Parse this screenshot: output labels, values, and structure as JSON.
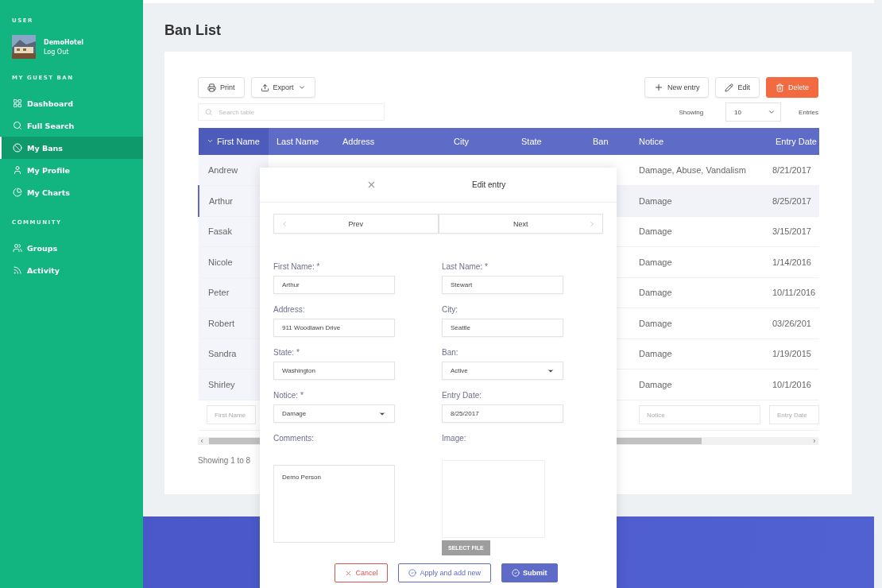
{
  "sidebar": {
    "user_heading": "USER",
    "user": {
      "name": "DemoHotel",
      "logout": "Log Out"
    },
    "sections": [
      {
        "heading": "MY GUEST BAN",
        "items": [
          {
            "label": "Dashboard",
            "selected": false
          },
          {
            "label": "Full Search",
            "selected": false
          },
          {
            "label": "My Bans",
            "selected": true
          },
          {
            "label": "My Profile",
            "selected": false
          },
          {
            "label": "My Charts",
            "selected": false
          }
        ]
      },
      {
        "heading": "COMMUNITY",
        "items": [
          {
            "label": "Groups",
            "selected": false
          },
          {
            "label": "Activity",
            "selected": false
          }
        ]
      }
    ]
  },
  "page_title": "Ban List",
  "toolbar": {
    "print": "Print",
    "export": "Export",
    "new_entry": "New entry",
    "edit": "Edit",
    "delete": "Delete",
    "search_placeholder": "Search table",
    "showing": "Showing",
    "page_size": "10",
    "entries": "Entries"
  },
  "table": {
    "columns": [
      "First Name",
      "Last Name",
      "Address",
      "City",
      "State",
      "Ban",
      "Notice",
      "Entry Date"
    ],
    "rows": [
      {
        "first_name": "Andrew",
        "notice": "Damage, Abuse, Vandalism",
        "entry_date": "8/21/2017",
        "selected": false
      },
      {
        "first_name": "Arthur",
        "notice": "Damage",
        "entry_date": "8/25/2017",
        "selected": true
      },
      {
        "first_name": "Fasak",
        "notice": "Damage",
        "entry_date": "3/15/2017",
        "selected": false
      },
      {
        "first_name": "Nicole",
        "notice": "Damage",
        "entry_date": "1/14/2016",
        "selected": false
      },
      {
        "first_name": "Peter",
        "notice": "Damage",
        "entry_date": "10/11/2016",
        "selected": false
      },
      {
        "first_name": "Robert",
        "notice": "Damage",
        "entry_date": "03/26/201",
        "selected": false
      },
      {
        "first_name": "Sandra",
        "notice": "Damage",
        "entry_date": "1/19/2015",
        "selected": false
      },
      {
        "first_name": "Shirley",
        "notice": "Damage",
        "entry_date": "10/1/2016",
        "selected": false
      }
    ],
    "filters": {
      "first_name": {
        "placeholder": "First Name"
      },
      "notice": {
        "placeholder": "Notice"
      },
      "entry_date": {
        "placeholder": "Entry Date"
      }
    },
    "footer": "Showing 1 to 8"
  },
  "modal": {
    "title": "Edit entry",
    "prev": "Prev",
    "next": "Next",
    "fields": [
      {
        "label": "First Name: *",
        "value": "Arthur",
        "kind": "text"
      },
      {
        "label": "Last Name: *",
        "value": "Stewart",
        "kind": "text"
      },
      {
        "label": "Address:",
        "value": "911 Woodlawn Drive",
        "kind": "text"
      },
      {
        "label": "City:",
        "value": "Seattle",
        "kind": "text"
      },
      {
        "label": "State: *",
        "value": "Washington",
        "kind": "text"
      },
      {
        "label": "Ban:",
        "value": "Active",
        "kind": "select"
      },
      {
        "label": "Notice: *",
        "value": "Damage",
        "kind": "select"
      },
      {
        "label": "Entry Date:",
        "value": "8/25/2017",
        "kind": "text"
      }
    ],
    "comments": {
      "label": "Comments:",
      "value": "Demo Person"
    },
    "image": {
      "label": "Image:",
      "button": "SELECT FILE"
    },
    "buttons": {
      "cancel": "Cancel",
      "apply": "Apply and add new",
      "submit": "Submit"
    }
  }
}
